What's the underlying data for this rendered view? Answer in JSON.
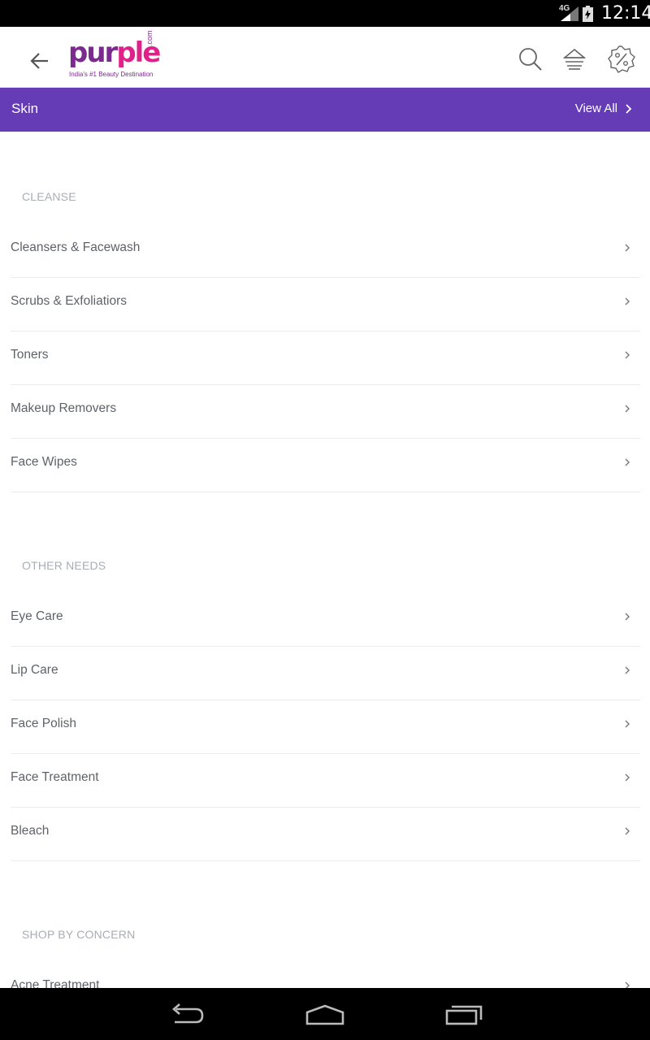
{
  "status_bar": {
    "network": "4G",
    "time": "12:14"
  },
  "app_bar": {
    "logo_part1": "pur",
    "logo_part2": "ple",
    "logo_dotcom": ".com",
    "logo_tagline": "India's #1 Beauty Destination",
    "icons": [
      "back-arrow-icon",
      "search-icon",
      "cart-icon",
      "offers-percent-icon"
    ]
  },
  "category_header": {
    "title": "Skin",
    "view_all": "View All"
  },
  "sections": [
    {
      "title": "CLEANSE",
      "items": [
        "Cleansers & Facewash",
        "Scrubs & Exfoliatiors",
        "Toners",
        "Makeup Removers",
        "Face Wipes"
      ]
    },
    {
      "title": "OTHER NEEDS",
      "items": [
        "Eye Care",
        "Lip Care",
        "Face Polish",
        "Face Treatment",
        "Bleach"
      ]
    },
    {
      "title": "SHOP BY CONCERN",
      "items": [
        "Acne Treatment"
      ]
    }
  ],
  "colors": {
    "accent": "#653bb6",
    "brand_purple": "#7b2a8e",
    "brand_pink": "#e0218a",
    "text": "#5f6368",
    "section_title": "#a9adb4"
  }
}
